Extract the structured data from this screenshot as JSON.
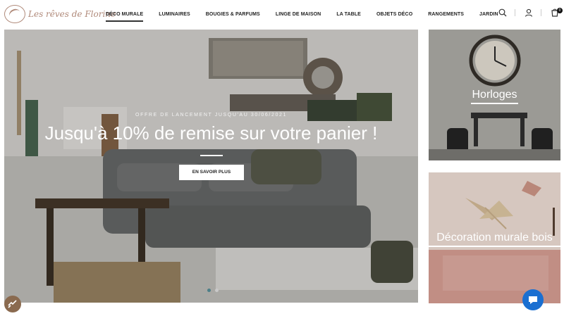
{
  "brand": {
    "name": "Les rêves de Florine"
  },
  "nav": {
    "items": [
      {
        "label": "DÉCO MURALE",
        "active": true
      },
      {
        "label": "LUMINAIRES",
        "active": false
      },
      {
        "label": "BOUGIES & PARFUMS",
        "active": false
      },
      {
        "label": "LINGE DE MAISON",
        "active": false
      },
      {
        "label": "LA TABLE",
        "active": false
      },
      {
        "label": "OBJETS DÉCO",
        "active": false
      },
      {
        "label": "RANGEMENTS",
        "active": false
      },
      {
        "label": "JARDIN",
        "active": false
      }
    ]
  },
  "header_icons": {
    "search": "search-icon",
    "account": "user-icon",
    "cart": "cart-icon",
    "cart_count": "0"
  },
  "hero": {
    "kicker": "OFFRE DE LANCEMENT JUSQU'AU 30/06/2021",
    "title": "Jusqu'à 10% de remise sur votre panier !",
    "button": "EN SAVOIR PLUS",
    "slides_count": 2,
    "active_slide": 1
  },
  "tiles": [
    {
      "label": "Horloges"
    },
    {
      "label": "Décoration murale bois"
    }
  ],
  "colors": {
    "brand": "#b08a7a",
    "dot_active": "#4c7f88",
    "chat": "#1a6fd1"
  }
}
